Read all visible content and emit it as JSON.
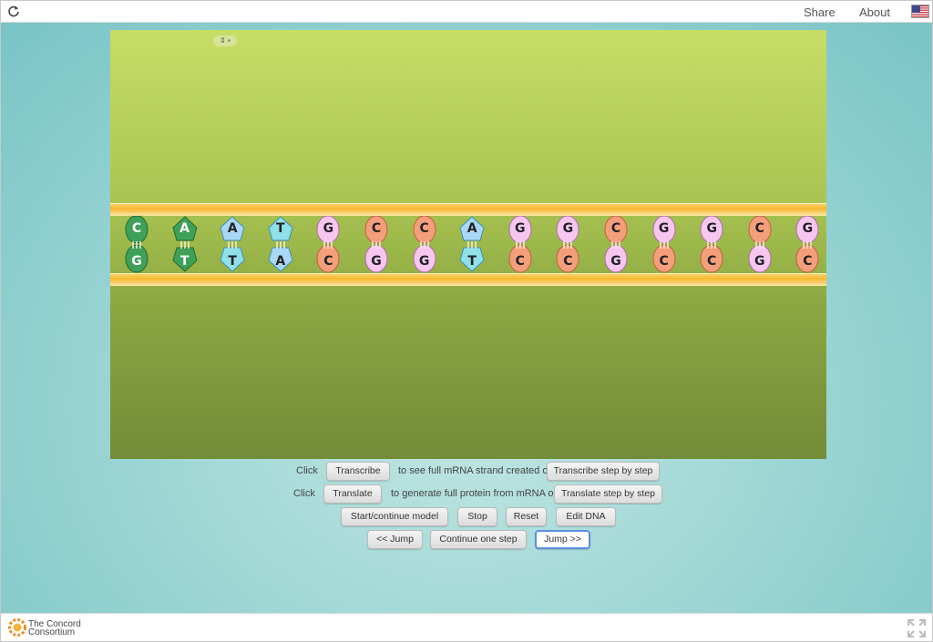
{
  "topbar": {
    "share_label": "Share",
    "about_label": "About",
    "reload_icon": "reload-icon",
    "language_icon": "us-flag-icon"
  },
  "model": {
    "lock_icon": "lock-icon",
    "top_strand": [
      "C",
      "A",
      "A",
      "T",
      "G",
      "C",
      "C",
      "A",
      "G",
      "G",
      "C",
      "G",
      "G",
      "C",
      "G"
    ],
    "bottom_strand": [
      "G",
      "T",
      "T",
      "A",
      "C",
      "G",
      "G",
      "T",
      "C",
      "C",
      "G",
      "C",
      "C",
      "G",
      "C"
    ],
    "colors": {
      "A": "#3fa05a",
      "T_top": "#8cd9e6",
      "T_bot": "#8cd9e6",
      "G": "#f6c7f1",
      "C": "#f49a77",
      "green_A": "#3aa046",
      "green_C": "#3aa046",
      "blue_A": "#9fd5f2",
      "backbone": "#f8b92e"
    }
  },
  "controls": {
    "row1": {
      "click": "Click",
      "transcribe": "Transcribe",
      "mid": "to see full mRNA strand created or",
      "transcribe_step": "Transcribe step by step"
    },
    "row2": {
      "click": "Click",
      "translate": "Translate",
      "mid": "to generate full protein from mRNA or",
      "translate_step": "Translate step by step"
    },
    "row3": {
      "start": "Start/continue model",
      "stop": "Stop",
      "reset": "Reset",
      "edit": "Edit DNA"
    },
    "row4": {
      "back_jump": "<< Jump",
      "continue_step": "Continue one step",
      "fwd_jump": "Jump >>"
    }
  },
  "footer": {
    "logo_line1": "The Concord",
    "logo_line2": "Consortium",
    "fullscreen_icon": "fullscreen-icon"
  }
}
